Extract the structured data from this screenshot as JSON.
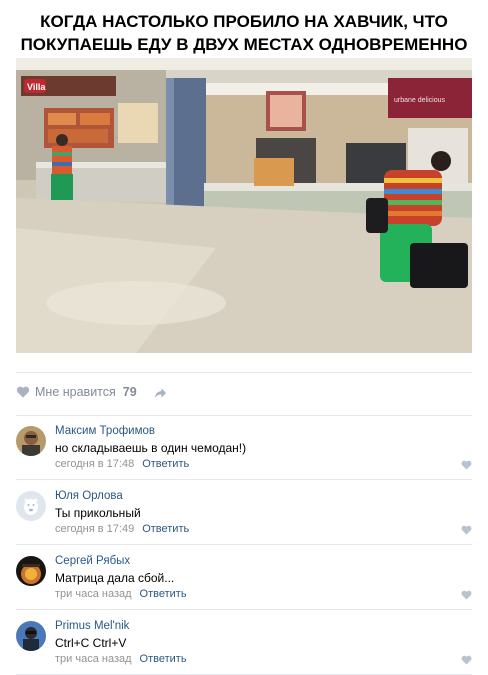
{
  "caption": {
    "line1": "КОГДА НАСТОЛЬКО ПРОБИЛО НА ХАВЧИК, ЧТО",
    "line2": "ПОКУПАЕШЬ ЕДУ В ДВУХ МЕСТАХ ОДНОВРЕМЕННО"
  },
  "photo": {
    "sign_left": "Villa",
    "sign_right": "urbane delicious"
  },
  "likes": {
    "label": "Мне нравится",
    "count": "79",
    "icons": [
      "heart-icon",
      "share-icon"
    ]
  },
  "comments": [
    {
      "author": "Максим Трофимов",
      "text": "но складываешь в один чемодан!)",
      "time": "сегодня в 17:48",
      "reply": "Ответить"
    },
    {
      "author": "Юля Орлова",
      "text": "Ты прикольный",
      "time": "сегодня в 17:49",
      "reply": "Ответить"
    },
    {
      "author": "Сергей Рябых",
      "text": "Матрица дала сбой...",
      "time": "три часа назад",
      "reply": "Ответить"
    },
    {
      "author": "Primus Mel'nik",
      "text": "Ctrl+C Ctrl+V",
      "time": "три часа назад",
      "reply": "Ответить"
    }
  ],
  "colors": {
    "link": "#2a5885",
    "muted": "#828a99",
    "divider": "#e7e8ec"
  }
}
